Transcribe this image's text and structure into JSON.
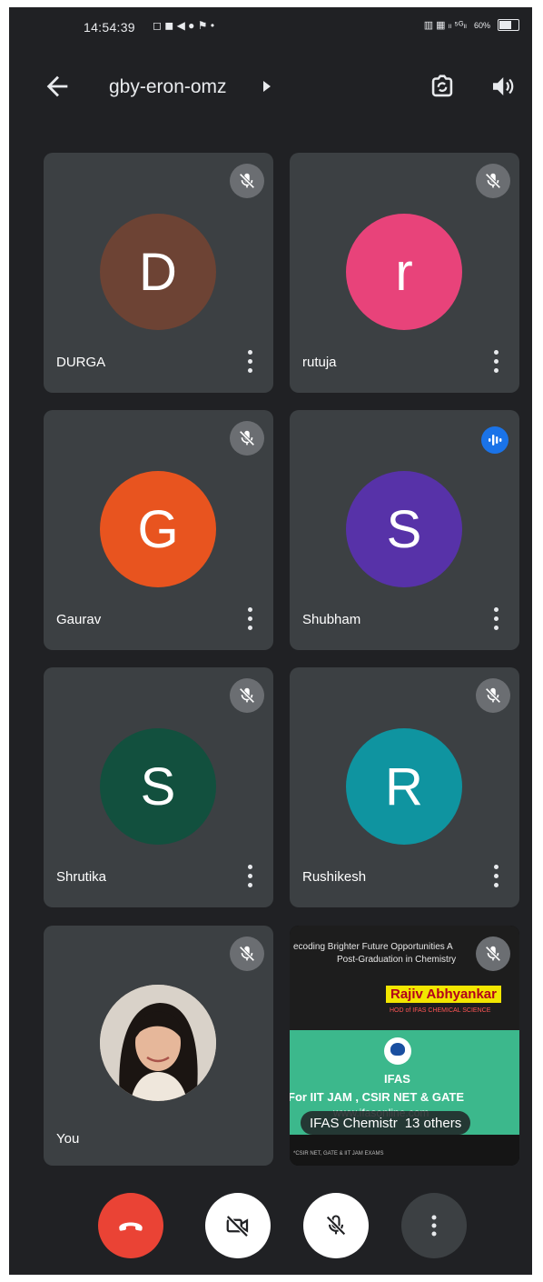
{
  "status_bar": {
    "time": "14:54:39",
    "icons_text": "◻ ◼ ◀ ● ⚑ •",
    "network_text": "▥ ▦ ₗₗ ⁵ᴳₗₗ",
    "battery": "60%"
  },
  "top_bar": {
    "meeting_code": "gby-eron-omz"
  },
  "tiles": [
    {
      "name": "DURGA",
      "initial": "D",
      "color": "#6d4334",
      "muted": true
    },
    {
      "name": "rutuja",
      "initial": "r",
      "color": "#e8437a",
      "muted": true
    },
    {
      "name": "Gaurav",
      "initial": "G",
      "color": "#e8541f",
      "muted": true
    },
    {
      "name": "Shubham",
      "initial": "S",
      "color": "#5732a8",
      "speaking": true
    },
    {
      "name": "Shrutika",
      "initial": "S",
      "color": "#12503e",
      "muted": true
    },
    {
      "name": "Rushikesh",
      "initial": "R",
      "color": "#0f94a0",
      "muted": true
    }
  ],
  "self_tile": {
    "name": "You",
    "muted": true
  },
  "shared_tile": {
    "line1": "ecoding Brighter Future Opportunities A",
    "line2": "Post-Graduation in Chemistry",
    "presenter": "Rajiv Abhyankar",
    "presenter_sub": "HOD of IFAS CHEMICAL SCIENCE",
    "org": "IFAS",
    "courses": "For IIT JAM , CSIR NET & GATE",
    "website": "www.ifasonline.com",
    "footer": "*CSIR NET, GATE & IIT JAM EXAMS",
    "chip_label": "IFAS Chemistr",
    "chip_others": "13 others"
  },
  "colors": {
    "background": "#202124",
    "tile": "#3c4043",
    "end_call": "#ea4335",
    "speaking_blue": "#1a73e8"
  }
}
